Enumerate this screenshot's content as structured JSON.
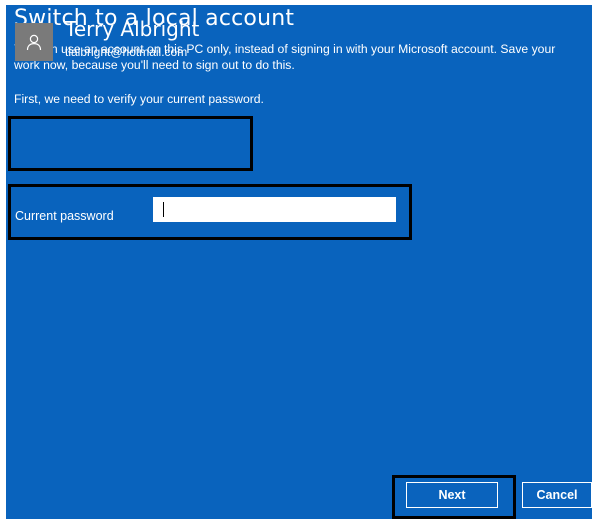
{
  "title": "Switch to a local account",
  "description": "You can use an account on this PC only, instead of signing in with your Microsoft account. Save your work now, because you'll need to sign out to do this.",
  "verify_text": "First, we need to verify your current password.",
  "user": {
    "name": "Terry Albright",
    "email": "tlalbright@hotmail.com",
    "avatar_icon": "person-icon"
  },
  "password": {
    "label": "Current password",
    "value": ""
  },
  "buttons": {
    "next": "Next",
    "cancel": "Cancel"
  },
  "colors": {
    "background": "#0963bd",
    "highlight_border": "#000000",
    "avatar_bg": "#7a7a7a"
  }
}
